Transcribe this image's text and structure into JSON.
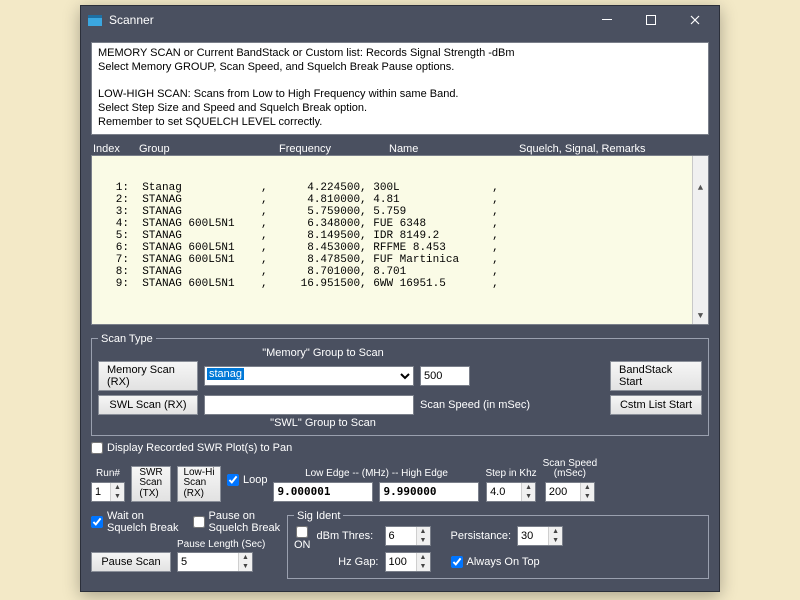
{
  "window": {
    "title": "Scanner"
  },
  "info": "MEMORY SCAN or Current BandStack or Custom list:  Records Signal Strength -dBm\nSelect Memory GROUP, Scan Speed, and Squelch Break Pause options.\n\nLOW-HIGH SCAN: Scans from Low to High Frequency within same Band.\nSelect Step Size and Speed and Squelch Break option.\nRemember to set SQUELCH LEVEL correctly.",
  "list": {
    "headers": {
      "index": "Index",
      "group": "Group",
      "frequency": "Frequency",
      "name": "Name",
      "sqlsig": "Squelch, Signal, Remarks"
    },
    "rows": [
      {
        "idx": "1:",
        "group": "Stanag",
        "freq": "4.224500",
        "name": "300L"
      },
      {
        "idx": "2:",
        "group": "STANAG",
        "freq": "4.810000",
        "name": "4.81"
      },
      {
        "idx": "3:",
        "group": "STANAG",
        "freq": "5.759000",
        "name": "5.759"
      },
      {
        "idx": "4:",
        "group": "STANAG 600L5N1",
        "freq": "6.348000",
        "name": "FUE 6348"
      },
      {
        "idx": "5:",
        "group": "STANAG",
        "freq": "8.149500",
        "name": "IDR 8149.2"
      },
      {
        "idx": "6:",
        "group": "STANAG 600L5N1",
        "freq": "8.453000",
        "name": "RFFME 8.453"
      },
      {
        "idx": "7:",
        "group": "STANAG 600L5N1",
        "freq": "8.478500",
        "name": "FUF Martinica"
      },
      {
        "idx": "8:",
        "group": "STANAG",
        "freq": "8.701000",
        "name": "8.701"
      },
      {
        "idx": "9:",
        "group": "STANAG 600L5N1",
        "freq": "16.951500",
        "name": "6WW 16951.5"
      }
    ]
  },
  "scanType": {
    "legend": "Scan Type",
    "memoryGroupLabel": "\"Memory\" Group to Scan",
    "swlGroupLabel": "\"SWL\" Group to Scan",
    "memoryScanBtn": "Memory Scan (RX)",
    "swlScanBtn": "SWL Scan (RX)",
    "memoryGroupValue": "stanag",
    "swlGroupValue": "",
    "scanSpeedValue": "500",
    "scanSpeedLabel": "Scan Speed (in mSec)",
    "bandstackBtn": "BandStack Start",
    "customListBtn": "Cstm List Start"
  },
  "swrLine": {
    "displaySwrLabel": "Display Recorded SWR Plot(s) to Pan",
    "displaySwrChecked": false,
    "runLabel": "Run#",
    "runValue": "1",
    "swrScanBtn": "SWR\nScan\n(TX)",
    "lowHiScanBtn": "Low-Hi\nScan\n(RX)",
    "loopLabel": "Loop",
    "loopChecked": true,
    "edgeLabel": "Low Edge --  (MHz)  --  High Edge",
    "lowEdge": "9.000001",
    "highEdge": "9.990000",
    "stepLabel": "Step in Khz",
    "stepValue": "4.0",
    "scanSpeedLabel": "Scan Speed\n(mSec)",
    "scanSpeedValue": "200"
  },
  "bottom": {
    "waitSqlLabel": "Wait on\nSquelch Break",
    "waitSqlChecked": true,
    "pauseSqlLabel": "Pause on\nSquelch Break",
    "pauseSqlChecked": false,
    "pauseLenLabel": "Pause Length (Sec)",
    "pauseLenValue": "5",
    "pauseScanBtn": "Pause Scan",
    "sigIdent": {
      "legend": "Sig Ident",
      "onLabel": "ON",
      "onChecked": false,
      "dbmLabel": "dBm Thres:",
      "dbmValue": "6",
      "hzLabel": "Hz Gap:",
      "hzValue": "100",
      "persistLabel": "Persistance:",
      "persistValue": "30"
    },
    "alwaysOnTopLabel": "Always On Top",
    "alwaysOnTopChecked": true
  }
}
